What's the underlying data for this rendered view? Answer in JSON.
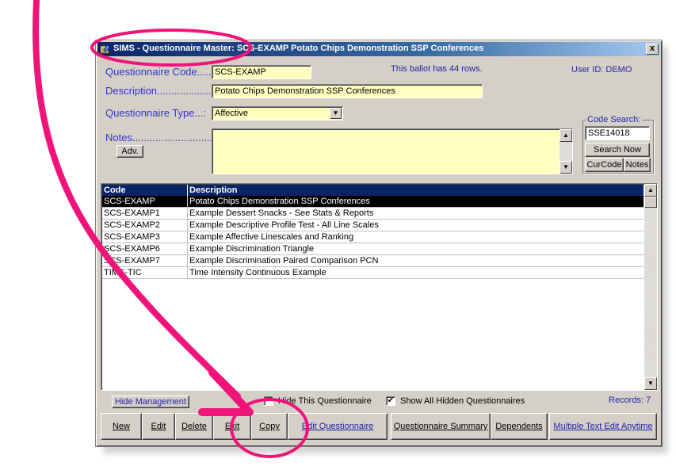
{
  "window": {
    "title": "SIMS - Questionnaire Master: SCS-EXAMP  Potato Chips Demonstration SSP Conferences",
    "close_label": "x"
  },
  "form": {
    "code_label": "Questionnaire Code......:",
    "code_value": "SCS-EXAMP",
    "ballot_info": "This ballot has 44 rows.",
    "user_info": "User ID: DEMO",
    "description_label": "Description....................:",
    "description_value": "Potato Chips Demonstration SSP Conferences",
    "type_label": "Questionnaire Type...:",
    "type_value": "Affective",
    "notes_label": "Notes..............................:",
    "notes_value": "",
    "adv_button": "Adv."
  },
  "code_search": {
    "label": "Code Search:",
    "value": "SSE14018",
    "search_now": "Search Now",
    "curcode": "CurCode",
    "notes": "Notes"
  },
  "grid": {
    "columns": [
      "Code",
      "Description"
    ],
    "rows": [
      {
        "code": "SCS-EXAMP",
        "description": "Potato Chips Demonstration SSP Conferences"
      },
      {
        "code": "SCS-EXAMP1",
        "description": "Example Dessert Snacks - See Stats & Reports"
      },
      {
        "code": "SCS-EXAMP2",
        "description": "Example Descriptive Profile Test - All Line Scales"
      },
      {
        "code": "SCS-EXAMP3",
        "description": "Example Affective Linescales and Ranking"
      },
      {
        "code": "SCS-EXAMP6",
        "description": "Example Discrimination Triangle"
      },
      {
        "code": "SCS-EXAMP7",
        "description": "Example Discrimination Paired Comparison PCN"
      },
      {
        "code": "TIME-TIC",
        "description": "Time Intensity Continuous Example"
      }
    ],
    "selected_index": 0
  },
  "footer": {
    "hide_management": "Hide Management",
    "hide_this_label": "Hide This Questionnaire",
    "hide_this_checked": false,
    "show_hidden_label": "Show All Hidden Questionnaires",
    "show_hidden_checked": true,
    "records": "Records: 7"
  },
  "buttons": {
    "new": "New",
    "edit": "Edit",
    "delete": "Delete",
    "exit": "Exit",
    "copy": "Copy",
    "edit_questionnaire": "Edit Questionnaire",
    "summary": "Questionnaire Summary",
    "dependents": "Dependents",
    "multiple_text_edit": "Multiple Text Edit Anytime"
  },
  "colors": {
    "annotation": "#f0147a",
    "label_blue": "#3333cc",
    "field_yellow": "#ffffc0",
    "title_blue": "#0a246a"
  }
}
